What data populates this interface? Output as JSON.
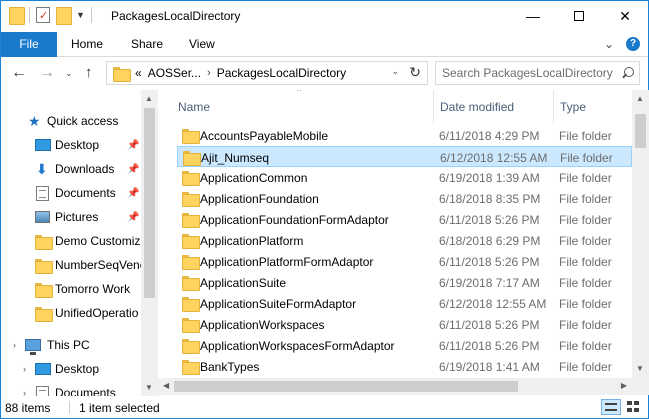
{
  "window": {
    "title": "PackagesLocalDirectory",
    "minimize_glyph": "—",
    "close_glyph": "✕"
  },
  "ribbon": {
    "tabs": [
      "File",
      "Home",
      "Share",
      "View"
    ],
    "collapse_glyph": "⌄",
    "help_glyph": "?"
  },
  "nav": {
    "back_glyph": "←",
    "forward_glyph": "→",
    "recent_glyph": "⌄",
    "up_glyph": "↑"
  },
  "address": {
    "overflow": "«",
    "crumbs": [
      "AOSSer...",
      "PackagesLocalDirectory"
    ],
    "separator": "›",
    "dropdown_glyph": "⌄",
    "refresh_glyph": "↻"
  },
  "search": {
    "placeholder": "Search PackagesLocalDirectory"
  },
  "navpane": {
    "quick_access": "Quick access",
    "pin_glyph": "📌",
    "chevron_glyph": "›",
    "items": [
      {
        "label": "Desktop",
        "icon": "desktop-icon",
        "pinned": true
      },
      {
        "label": "Downloads",
        "icon": "download-icon",
        "pinned": true
      },
      {
        "label": "Documents",
        "icon": "documents-icon",
        "pinned": true
      },
      {
        "label": "Pictures",
        "icon": "pictures-icon",
        "pinned": true
      },
      {
        "label": "Demo Customiz",
        "icon": "folder-icon",
        "pinned": false
      },
      {
        "label": "NumberSeqVenc",
        "icon": "folder-icon",
        "pinned": false
      },
      {
        "label": "Tomorro Work",
        "icon": "folder-icon",
        "pinned": false
      },
      {
        "label": "UnifiedOperatio",
        "icon": "folder-icon",
        "pinned": false
      }
    ],
    "this_pc": "This PC",
    "pc_items": [
      {
        "label": "Desktop",
        "icon": "desktop-icon"
      },
      {
        "label": "Documents",
        "icon": "documents-icon"
      }
    ]
  },
  "columns": {
    "name": "Name",
    "date": "Date modified",
    "type": "Type",
    "sort_glyph": "^"
  },
  "files": [
    {
      "name": "AccountsPayableMobile",
      "date": "6/11/2018 4:29 PM",
      "type": "File folder",
      "selected": false
    },
    {
      "name": "Ajit_Numseq",
      "date": "6/12/2018 12:55 AM",
      "type": "File folder",
      "selected": true
    },
    {
      "name": "ApplicationCommon",
      "date": "6/19/2018 1:39 AM",
      "type": "File folder",
      "selected": false
    },
    {
      "name": "ApplicationFoundation",
      "date": "6/18/2018 8:35 PM",
      "type": "File folder",
      "selected": false
    },
    {
      "name": "ApplicationFoundationFormAdaptor",
      "date": "6/11/2018 5:26 PM",
      "type": "File folder",
      "selected": false
    },
    {
      "name": "ApplicationPlatform",
      "date": "6/18/2018 6:29 PM",
      "type": "File folder",
      "selected": false
    },
    {
      "name": "ApplicationPlatformFormAdaptor",
      "date": "6/11/2018 5:26 PM",
      "type": "File folder",
      "selected": false
    },
    {
      "name": "ApplicationSuite",
      "date": "6/19/2018 7:17 AM",
      "type": "File folder",
      "selected": false
    },
    {
      "name": "ApplicationSuiteFormAdaptor",
      "date": "6/12/2018 12:55 AM",
      "type": "File folder",
      "selected": false
    },
    {
      "name": "ApplicationWorkspaces",
      "date": "6/11/2018 5:26 PM",
      "type": "File folder",
      "selected": false
    },
    {
      "name": "ApplicationWorkspacesFormAdaptor",
      "date": "6/11/2018 5:26 PM",
      "type": "File folder",
      "selected": false
    },
    {
      "name": "BankTypes",
      "date": "6/19/2018 1:41 AM",
      "type": "File folder",
      "selected": false
    }
  ],
  "scroll": {
    "up_glyph": "▲",
    "down_glyph": "▼",
    "left_glyph": "◀",
    "right_glyph": "▶"
  },
  "status": {
    "count": "88 items",
    "selection": "1 item selected"
  },
  "colors": {
    "accent": "#1979ca",
    "selection_bg": "#cce8ff",
    "selection_border": "#99d1ff",
    "folder": "#ffd45e"
  }
}
